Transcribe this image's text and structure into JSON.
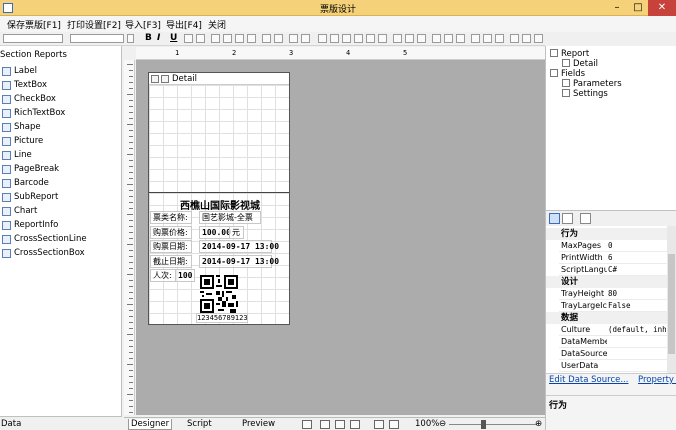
{
  "window": {
    "title": "票版设计",
    "controls": [
      "–",
      "□",
      "✕"
    ]
  },
  "menu": [
    "保存票版[F1]",
    "打印设置[F2]",
    "导入[F3]",
    "导出[F4]",
    "关闭"
  ],
  "toolbar": {
    "bold": "B",
    "italic": "I",
    "underline": "U"
  },
  "left_panel": {
    "header": "Section Reports",
    "tools": [
      {
        "label": "Label",
        "icon": "label-icon"
      },
      {
        "label": "TextBox",
        "icon": "textbox-icon"
      },
      {
        "label": "CheckBox",
        "icon": "checkbox-icon"
      },
      {
        "label": "RichTextBox",
        "icon": "richtextbox-icon"
      },
      {
        "label": "Shape",
        "icon": "shape-icon"
      },
      {
        "label": "Picture",
        "icon": "picture-icon"
      },
      {
        "label": "Line",
        "icon": "line-icon"
      },
      {
        "label": "PageBreak",
        "icon": "pagebreak-icon"
      },
      {
        "label": "Barcode",
        "icon": "barcode-icon"
      },
      {
        "label": "SubReport",
        "icon": "subreport-icon"
      },
      {
        "label": "Chart",
        "icon": "chart-icon"
      },
      {
        "label": "ReportInfo",
        "icon": "reportinfo-icon"
      },
      {
        "label": "CrossSectionLine",
        "icon": "crosssectionline-icon"
      },
      {
        "label": "CrossSectionBox",
        "icon": "crosssectionbox-icon"
      }
    ],
    "bottom_tab": "Data"
  },
  "ruler": {
    "marks": [
      "1",
      "2",
      "3",
      "4",
      "5"
    ]
  },
  "report": {
    "band_label": "Detail",
    "cinema": "西樵山国际影视城",
    "rows": [
      {
        "label": "票类名称:",
        "value": "国艺影城-全票"
      },
      {
        "label": "购票价格:",
        "value": "100.00",
        "suffix": "元"
      },
      {
        "label": "购票日期:",
        "value": "2014-09-17 13:00"
      },
      {
        "label": "截止日期:",
        "value": "2014-09-17 13:00"
      },
      {
        "label": "人次:",
        "value": "100"
      }
    ],
    "barcode_text": "123456789123"
  },
  "bottom_tabs": {
    "designer": "Designer",
    "script": "Script",
    "preview": "Preview",
    "zoom": "100%",
    "zoom_minus": "⊖",
    "zoom_plus": "⊕"
  },
  "tree": {
    "root": "Report",
    "detail": "Detail",
    "fields": "Fields",
    "parameters": "Parameters",
    "settings": "Settings"
  },
  "properties": {
    "categories": [
      {
        "name": "行为",
        "rows": [
          {
            "key": "MaxPages",
            "value": "0"
          },
          {
            "key": "PrintWidth",
            "value": "6"
          },
          {
            "key": "ScriptLanguage",
            "value": "C#"
          }
        ]
      },
      {
        "name": "设计",
        "rows": [
          {
            "key": "TrayHeight",
            "value": "80"
          },
          {
            "key": "TrayLargeIcon",
            "value": "False"
          }
        ]
      },
      {
        "name": "数据",
        "rows": [
          {
            "key": "Culture",
            "value": "(default, inh"
          },
          {
            "key": "DataMember",
            "value": ""
          },
          {
            "key": "DataSource",
            "value": ""
          },
          {
            "key": "UserData",
            "value": ""
          }
        ]
      }
    ],
    "links": [
      "Edit Data Source...",
      "Property dialog"
    ],
    "description_title": "行为"
  }
}
